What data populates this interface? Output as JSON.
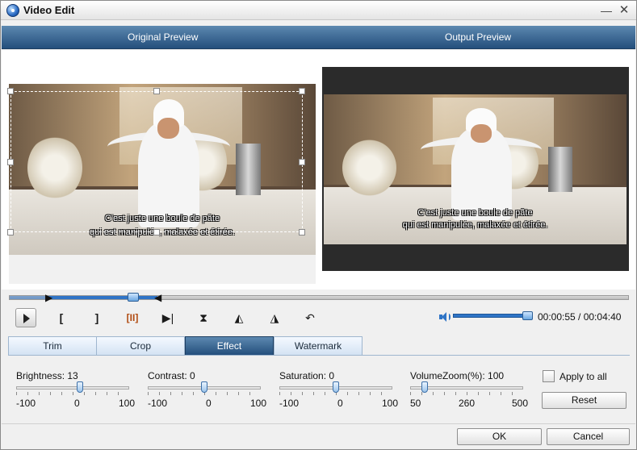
{
  "window": {
    "title": "Video Edit",
    "minimize": "—",
    "close": "✕"
  },
  "preview": {
    "original_label": "Original Preview",
    "output_label": "Output Preview",
    "subtitle_line1": "C'est juste une boule de pâte",
    "subtitle_line2": "qui est manipulée, malaxée et étirée."
  },
  "controls": {
    "start_glyph": "[",
    "end_glyph": "]",
    "split_glyph": "[II]",
    "next_glyph": "▶|",
    "flip_glyph": "⧗",
    "rotate_left_glyph": "◭",
    "rotate_right_glyph": "◮",
    "undo_glyph": "↶",
    "time": "00:00:55 / 00:04:40"
  },
  "tabs": [
    {
      "label": "Trim"
    },
    {
      "label": "Crop"
    },
    {
      "label": "Effect"
    },
    {
      "label": "Watermark"
    }
  ],
  "active_tab": "Effect",
  "effects": {
    "brightness": {
      "label": "Brightness:",
      "value": "13",
      "min": "-100",
      "mid": "0",
      "max": "100"
    },
    "contrast": {
      "label": "Contrast:",
      "value": "0",
      "min": "-100",
      "mid": "0",
      "max": "100"
    },
    "saturation": {
      "label": "Saturation:",
      "value": "0",
      "min": "-100",
      "mid": "0",
      "max": "100"
    },
    "volumezoom": {
      "label": "VolumeZoom(%):",
      "value": "100",
      "min": "50",
      "mid": "260",
      "max": "500"
    }
  },
  "apply_to_all": {
    "label": "Apply to all",
    "checked": false
  },
  "buttons": {
    "reset": "Reset",
    "ok": "OK",
    "cancel": "Cancel"
  },
  "volume_level": 1.0,
  "accent_color": "#2f74c6"
}
